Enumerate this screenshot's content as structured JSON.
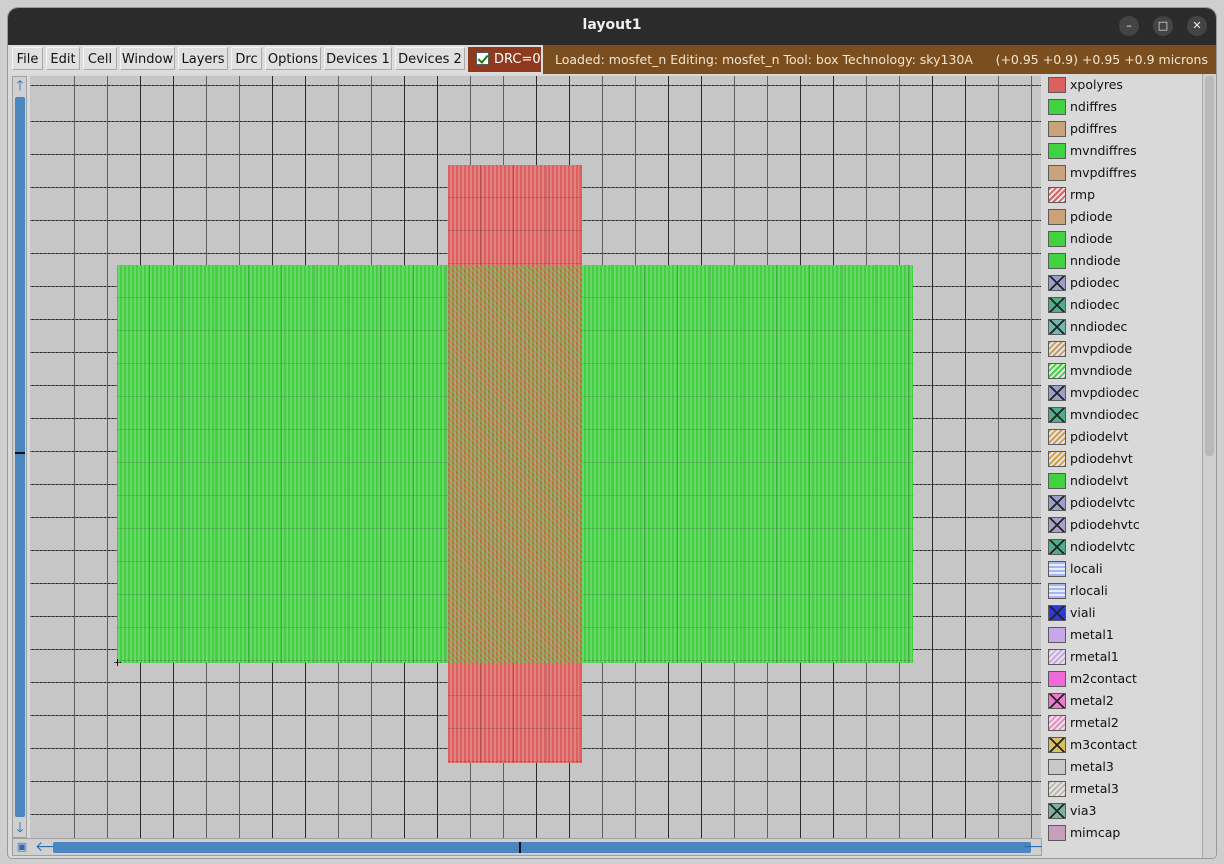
{
  "window": {
    "title": "layout1"
  },
  "window_controls": {
    "minimize": "–",
    "maximize": "□",
    "close": "✕"
  },
  "menu": [
    "File",
    "Edit",
    "Cell",
    "Window",
    "Layers",
    "Drc",
    "Options",
    "Devices 1",
    "Devices 2"
  ],
  "drc": {
    "label": "DRC=0",
    "checked": true
  },
  "status": {
    "info": "Loaded: mosfet_n Editing: mosfet_n Tool: box  Technology: sky130A",
    "coords": "(+0.95 +0.9) +0.95 +0.9 microns"
  },
  "colors": {
    "ndiff": "#3fd43f",
    "poly": "#df5f5f",
    "status_bar": "#7a4e1e",
    "drc_bg": "#8f3a1e",
    "scrollbar": "#4a86bf"
  },
  "layers": [
    {
      "name": "xpolyres",
      "color": "#df5f5f",
      "pattern": "solid"
    },
    {
      "name": "ndiffres",
      "color": "#3fd43f",
      "pattern": "solid"
    },
    {
      "name": "pdiffres",
      "color": "#caa37a",
      "pattern": "solid"
    },
    {
      "name": "mvndiffres",
      "color": "#3fd43f",
      "pattern": "solid"
    },
    {
      "name": "mvpdiffres",
      "color": "#caa37a",
      "pattern": "solid"
    },
    {
      "name": "rmp",
      "color": "#df5f5f",
      "pattern": "hatch"
    },
    {
      "name": "pdiode",
      "color": "#caa37a",
      "pattern": "solid"
    },
    {
      "name": "ndiode",
      "color": "#3fd43f",
      "pattern": "solid"
    },
    {
      "name": "nndiode",
      "color": "#3fd43f",
      "pattern": "solid"
    },
    {
      "name": "pdiodec",
      "color": "#9aa0c8",
      "pattern": "cross"
    },
    {
      "name": "ndiodec",
      "color": "#4fae8a",
      "pattern": "cross"
    },
    {
      "name": "nndiodec",
      "color": "#6fb7b0",
      "pattern": "cross"
    },
    {
      "name": "mvpdiode",
      "color": "#c79a6a",
      "pattern": "hatch"
    },
    {
      "name": "mvndiode",
      "color": "#3fd43f",
      "pattern": "hatch"
    },
    {
      "name": "mvpdiodec",
      "color": "#9aa0c8",
      "pattern": "cross"
    },
    {
      "name": "mvndiodec",
      "color": "#4fae8a",
      "pattern": "cross"
    },
    {
      "name": "pdiodelvt",
      "color": "#d39a55",
      "pattern": "hatch"
    },
    {
      "name": "pdiodehvt",
      "color": "#d3a045",
      "pattern": "hatch"
    },
    {
      "name": "ndiodelvt",
      "color": "#3fd43f",
      "pattern": "solid"
    },
    {
      "name": "pdiodelvtc",
      "color": "#9aa0c8",
      "pattern": "cross"
    },
    {
      "name": "pdiodehvtc",
      "color": "#a8a0c8",
      "pattern": "cross"
    },
    {
      "name": "ndiodelvtc",
      "color": "#4fae8a",
      "pattern": "cross"
    },
    {
      "name": "locali",
      "color": "#a9b7f0",
      "pattern": "grid"
    },
    {
      "name": "rlocali",
      "color": "#a9b7f0",
      "pattern": "grid"
    },
    {
      "name": "viali",
      "color": "#2a3bd8",
      "pattern": "cross"
    },
    {
      "name": "metal1",
      "color": "#c7a8e6",
      "pattern": "solid"
    },
    {
      "name": "rmetal1",
      "color": "#c7a8e6",
      "pattern": "hatch"
    },
    {
      "name": "m2contact",
      "color": "#ee6ad8",
      "pattern": "solid"
    },
    {
      "name": "metal2",
      "color": "#ee7ad0",
      "pattern": "cross"
    },
    {
      "name": "rmetal2",
      "color": "#ee8ac0",
      "pattern": "hatch"
    },
    {
      "name": "m3contact",
      "color": "#d8c060",
      "pattern": "cross"
    },
    {
      "name": "metal3",
      "color": "#c8c8c8",
      "pattern": "solid"
    },
    {
      "name": "rmetal3",
      "color": "#c0b8b0",
      "pattern": "hatch"
    },
    {
      "name": "via3",
      "color": "#7fb0a0",
      "pattern": "cross"
    },
    {
      "name": "mimcap",
      "color": "#c6a0b8",
      "pattern": "solid"
    }
  ]
}
